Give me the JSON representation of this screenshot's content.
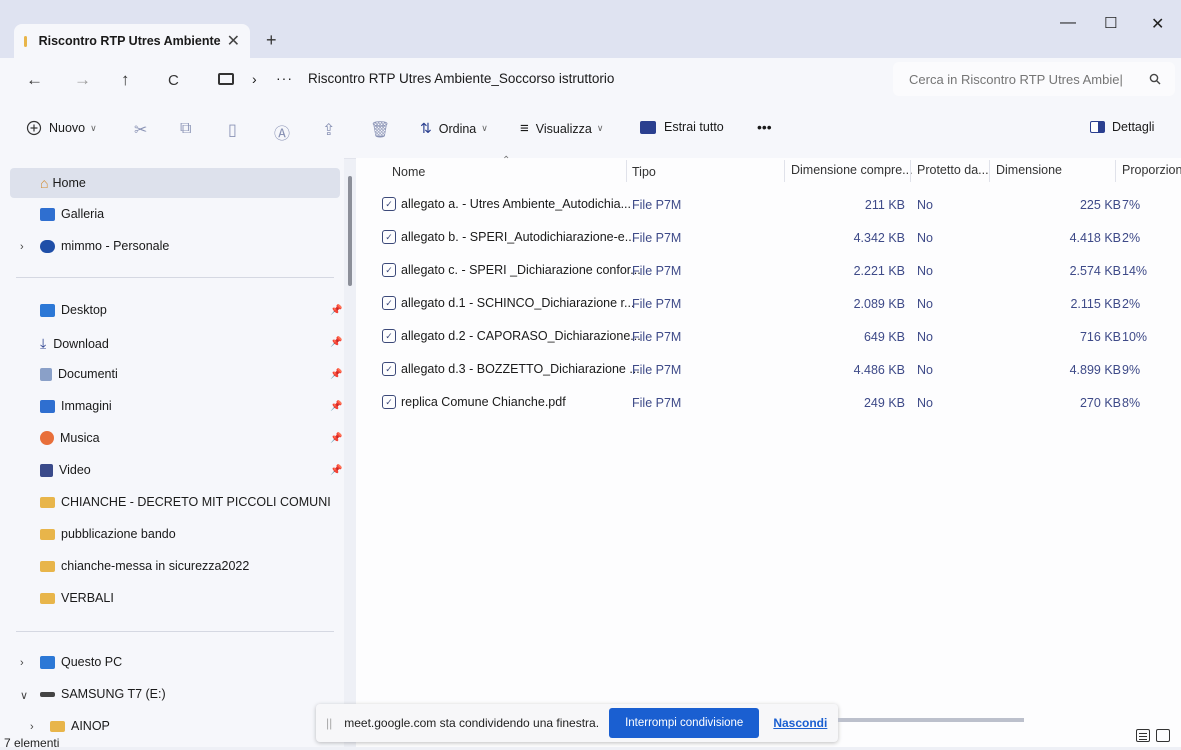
{
  "tab": {
    "title": "Riscontro RTP Utres Ambiente",
    "close": "✕",
    "new": "+"
  },
  "window": {
    "minimize": "—",
    "maximize": "☐",
    "close": "✕"
  },
  "nav": {
    "back": "←",
    "forward": "→",
    "up": "↑",
    "refresh": "C"
  },
  "address": {
    "separator": "›",
    "more": "···",
    "path": "Riscontro RTP Utres Ambiente_Soccorso istruttorio"
  },
  "search": {
    "placeholder": "Cerca in Riscontro RTP Utres Ambie|",
    "icon": "search-icon"
  },
  "toolbar": {
    "new_label": "Nuovo",
    "sort_label": "Ordina",
    "view_label": "Visualizza",
    "extract_label": "Estrai tutto",
    "more_label": "•••",
    "details_label": "Dettagli"
  },
  "sidebar": {
    "home": "Home",
    "gallery": "Galleria",
    "onedrive": "mimmo - Personale",
    "desktop": "Desktop",
    "download": "Download",
    "documents": "Documenti",
    "images": "Immagini",
    "music": "Musica",
    "video": "Video",
    "folder1": "CHIANCHE - DECRETO MIT PICCOLI COMUNI",
    "folder2": "pubblicazione bando",
    "folder3": "chianche-messa in sicurezza2022",
    "folder4": "VERBALI",
    "this_pc": "Questo PC",
    "drive": "SAMSUNG T7 (E:)",
    "ainop": "AINOP"
  },
  "columns": {
    "name": "Nome",
    "type": "Tipo",
    "compressed": "Dimensione compre...",
    "protected": "Protetto da...",
    "size": "Dimensione",
    "ratio": "Proporzion"
  },
  "files": [
    {
      "name": "allegato a. - Utres Ambiente_Autodichia...",
      "type": "File P7M",
      "compressed": "211 KB",
      "protected": "No",
      "size": "225 KB",
      "ratio": "7%"
    },
    {
      "name": "allegato b. - SPERI_Autodichiarazione-e...",
      "type": "File P7M",
      "compressed": "4.342 KB",
      "protected": "No",
      "size": "4.418 KB",
      "ratio": "2%"
    },
    {
      "name": "allegato c. - SPERI _Dichiarazione confor...",
      "type": "File P7M",
      "compressed": "2.221 KB",
      "protected": "No",
      "size": "2.574 KB",
      "ratio": "14%"
    },
    {
      "name": "allegato d.1 - SCHINCO_Dichiarazione r...",
      "type": "File P7M",
      "compressed": "2.089 KB",
      "protected": "No",
      "size": "2.115 KB",
      "ratio": "2%"
    },
    {
      "name": "allegato d.2 - CAPORASO_Dichiarazione...",
      "type": "File P7M",
      "compressed": "649 KB",
      "protected": "No",
      "size": "716 KB",
      "ratio": "10%"
    },
    {
      "name": "allegato d.3 - BOZZETTO_Dichiarazione ...",
      "type": "File P7M",
      "compressed": "4.486 KB",
      "protected": "No",
      "size": "4.899 KB",
      "ratio": "9%"
    },
    {
      "name": "replica Comune Chianche.pdf",
      "type": "File P7M",
      "compressed": "249 KB",
      "protected": "No",
      "size": "270 KB",
      "ratio": "8%"
    }
  ],
  "status": {
    "count": "7 elementi"
  },
  "share": {
    "message": "meet.google.com sta condividendo una finestra.",
    "stop_label": "Interrompi condivisione",
    "hide_label": "Nascondi"
  }
}
